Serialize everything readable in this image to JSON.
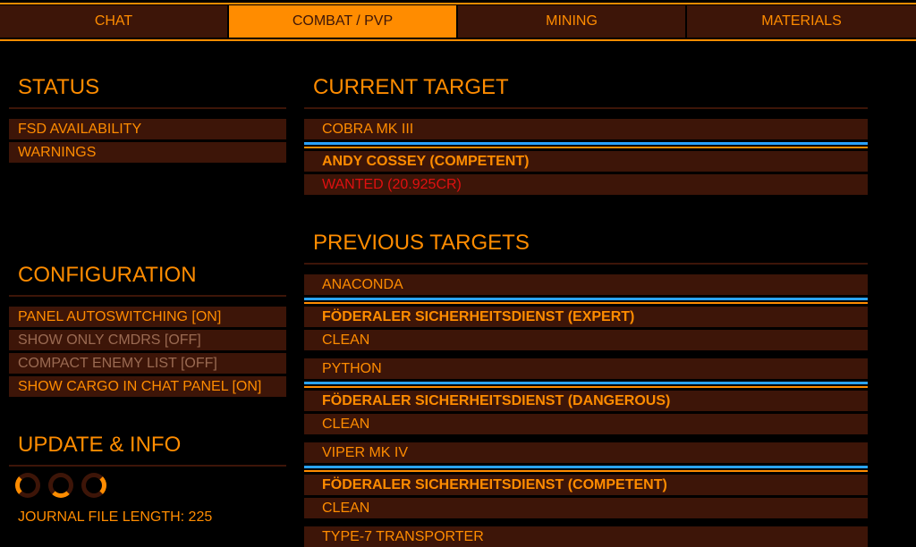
{
  "tabs": [
    "CHAT",
    "COMBAT / PVP",
    "MINING",
    "MATERIALS"
  ],
  "status": {
    "title": "STATUS",
    "items": [
      "FSD AVAILABILITY",
      "WARNINGS"
    ]
  },
  "configuration": {
    "title": "CONFIGURATION",
    "items": [
      "PANEL AUTOSWITCHING [ON]",
      "SHOW ONLY CMDRS [OFF]",
      "COMPACT ENEMY LIST [OFF]",
      "SHOW CARGO IN CHAT PANEL [ON]"
    ]
  },
  "update_info": {
    "title": "UPDATE & INFO",
    "journal_label": "JOURNAL FILE LENGTH: 225"
  },
  "current_target": {
    "title": "CURRENT TARGET",
    "ship": "COBRA MK III",
    "pilot": "ANDY COSSEY (COMPETENT)",
    "status": "WANTED (20.925CR)"
  },
  "previous_targets": {
    "title": "PREVIOUS TARGETS",
    "items": [
      {
        "ship": "ANACONDA",
        "pilot": "FÖDERALER SICHERHEITSDIENST (EXPERT)",
        "status": "CLEAN"
      },
      {
        "ship": "PYTHON",
        "pilot": "FÖDERALER SICHERHEITSDIENST (DANGEROUS)",
        "status": "CLEAN"
      },
      {
        "ship": "VIPER MK IV",
        "pilot": "FÖDERALER SICHERHEITSDIENST (COMPETENT)",
        "status": "CLEAN"
      },
      {
        "ship": "TYPE-7 TRANSPORTER"
      }
    ]
  },
  "colors": {
    "accent": "#ff8c00",
    "panel": "#3d1508",
    "divider_blue": "#2aa3ff",
    "wanted": "#e01010",
    "dim_text": "#9a6a52"
  }
}
